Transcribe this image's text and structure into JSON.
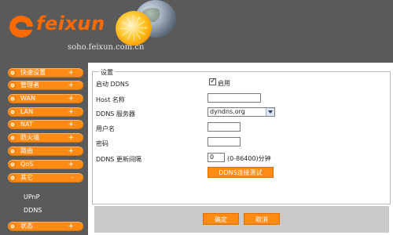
{
  "header": {
    "brand": "feixun",
    "tagline": "soho.feixun.com.cn"
  },
  "sidebar": {
    "items": [
      {
        "label": "快速设置",
        "plus": "+"
      },
      {
        "label": "管理者",
        "plus": "+"
      },
      {
        "label": "WAN",
        "plus": "+"
      },
      {
        "label": "LAN",
        "plus": "+"
      },
      {
        "label": "NAT",
        "plus": "+"
      },
      {
        "label": "防火墙",
        "plus": "+"
      },
      {
        "label": "路由",
        "plus": "+"
      },
      {
        "label": "QoS",
        "plus": "+"
      },
      {
        "label": "其它",
        "plus": "-"
      }
    ],
    "subitems": [
      "UPnP",
      "DDNS"
    ],
    "status": {
      "label": "状态",
      "plus": "+"
    }
  },
  "form": {
    "title": "设置",
    "enable_ddns_label": "启动 DDNS",
    "enable_ddns_checkbox_label": "启用",
    "host_label": "Host 名称",
    "host_value": "",
    "server_label": "DDNS  服务器",
    "server_selected": "dyndns.org",
    "username_label": "用户名",
    "username_value": "",
    "password_label": "密码",
    "password_value": "",
    "interval_label": "DDNS 更新间隔",
    "interval_value": "0",
    "interval_hint": "(0-86400)分钟",
    "test_button": "DDNS连接测试"
  },
  "footer": {
    "confirm": "确定",
    "cancel": "取消"
  },
  "colors": {
    "header_bg": "#5a5a5a",
    "accent": "#ff8a14"
  }
}
